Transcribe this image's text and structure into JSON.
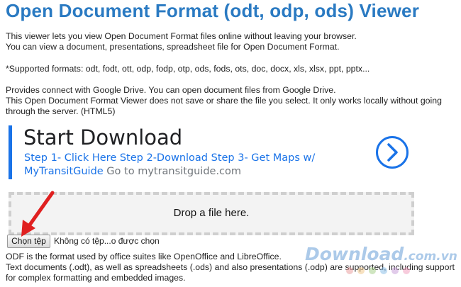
{
  "page": {
    "title": "Open Document Format (odt, odp, ods) Viewer",
    "intro_lines": [
      "This viewer lets you view Open Document Format files online without leaving your browser.",
      "You can view a document, presentations, spreadsheet file for Open Document Format."
    ],
    "supported_formats": "*Supported formats: odt, fodt, ott, odp, fodp, otp, ods, fods, ots, doc, docx, xls, xlsx, ppt, pptx...",
    "drive_lines": [
      "Provides connect with Google Drive. You can open document files from Google Drive.",
      "This Open Document Format Viewer does not save or share the file you select. It only works locally without going",
      "through the server. (HTML5)"
    ],
    "odf_lines": [
      "ODF is the format used by office suites like OpenOffice and LibreOffice.",
      "Text documents (.odt), as well as spreadsheets (.ods) and also presentations (.odp) are supported, including support",
      "for complex formatting and embedded images."
    ]
  },
  "ad": {
    "headline": "Start Download",
    "body_line1": "Step 1- Click Here Step 2-Download Step 3- Get Maps w/",
    "body_line2_brand": "MyTransitGuide",
    "body_line2_url": " Go to mytransitguide.com",
    "bar_color": "#1a73e8",
    "arrow_icon": "chevron-right-circle-icon"
  },
  "dropzone": {
    "label": "Drop a file here."
  },
  "file_input": {
    "button_label": "Chọn tệp",
    "status": "Không có tệp...o được chọn"
  },
  "watermark": {
    "text": "Download",
    "suffix": ".com.vn",
    "dot_colors": [
      "#e9a0a0",
      "#f0c88c",
      "#a8d08c",
      "#8cc0e8",
      "#c8a0d8",
      "#f0a0c0"
    ]
  },
  "colors": {
    "title": "#2a7ac2",
    "annotation_arrow": "#e02020"
  }
}
